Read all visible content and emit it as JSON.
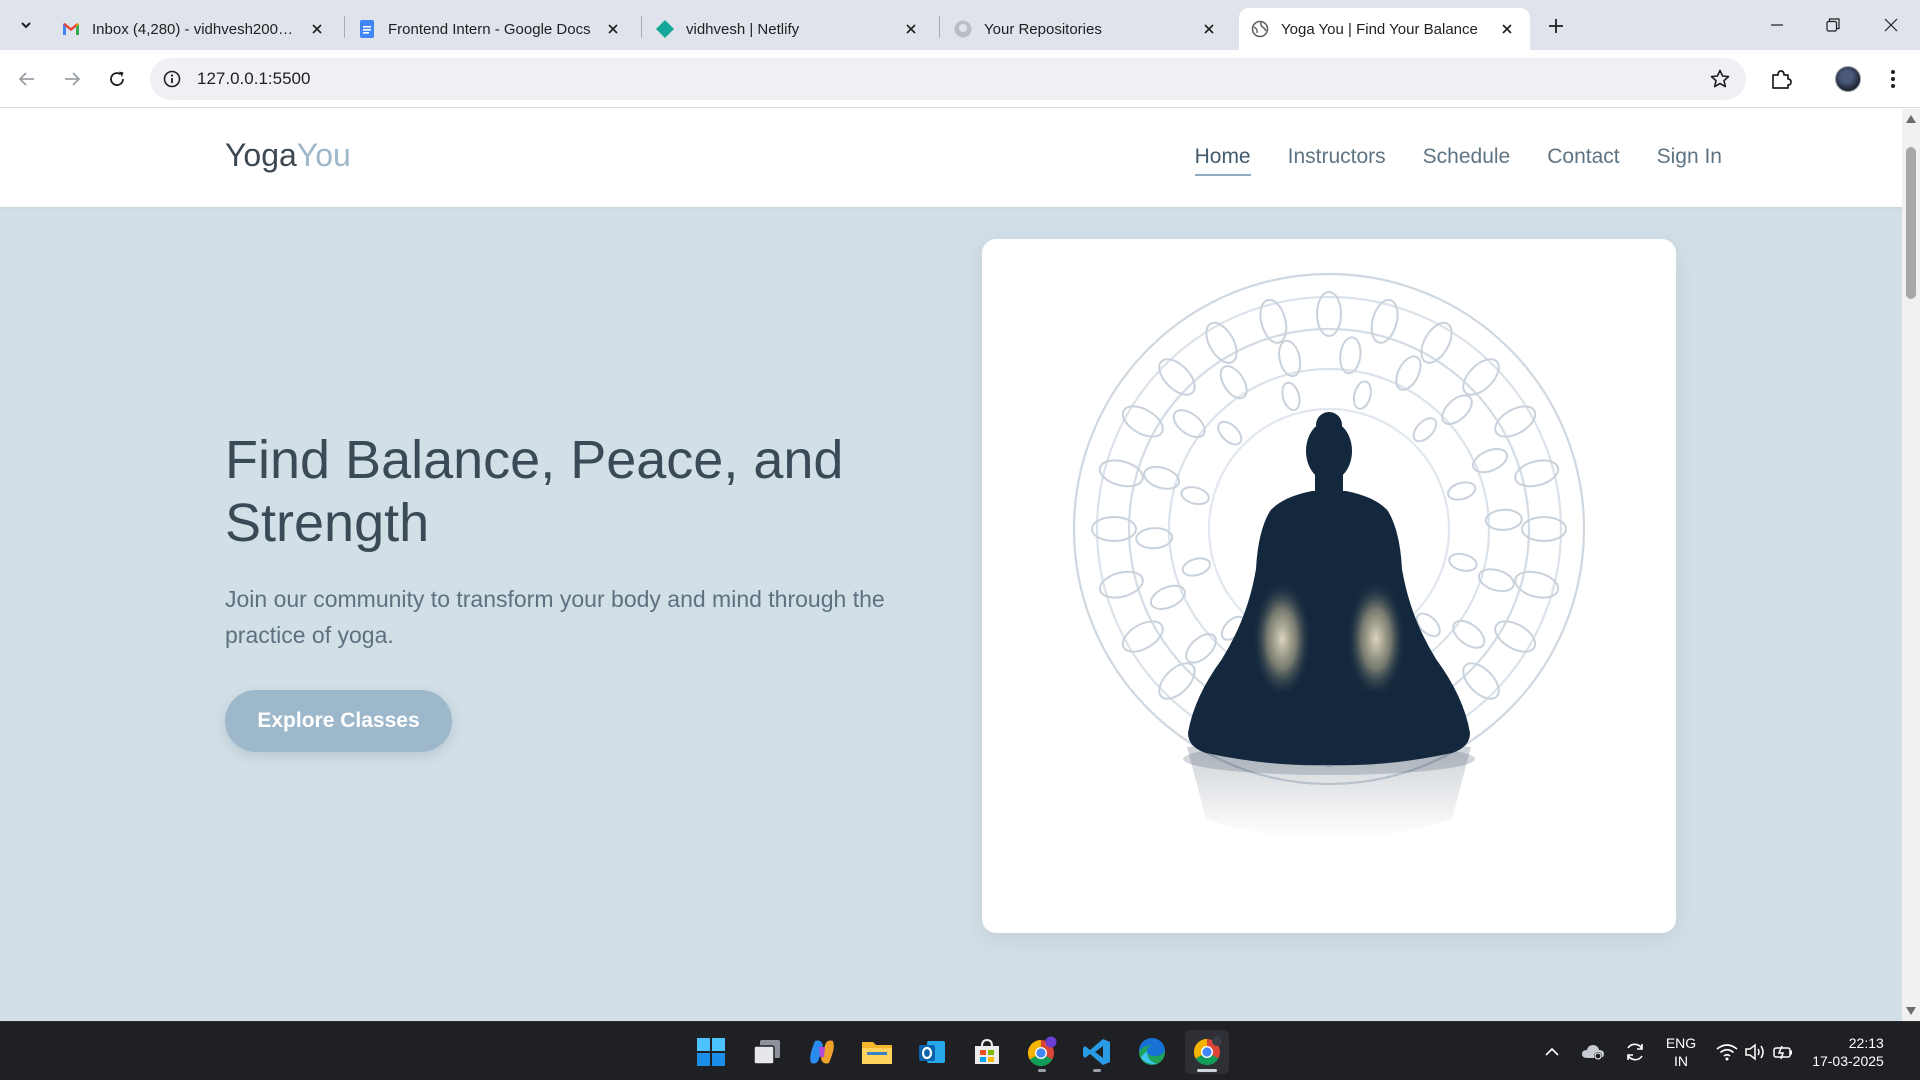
{
  "browser": {
    "tabs": [
      {
        "title": "Inbox (4,280) - vidhvesh2003@gmail.com",
        "favicon": "gmail-icon",
        "active": false
      },
      {
        "title": "Frontend Intern - Google Docs",
        "favicon": "docs-icon",
        "active": false
      },
      {
        "title": "vidhvesh | Netlify",
        "favicon": "netlify-icon",
        "active": false
      },
      {
        "title": "Your Repositories",
        "favicon": "github-icon",
        "active": false
      },
      {
        "title": "Yoga You | Find Your Balance",
        "favicon": "globe-icon",
        "active": true
      }
    ],
    "url": "127.0.0.1:5500"
  },
  "site": {
    "logo_main": "Yoga",
    "logo_accent": "You",
    "nav": [
      "Home",
      "Instructors",
      "Schedule",
      "Contact",
      "Sign In"
    ],
    "active_nav": "Home",
    "hero": {
      "title": "Find Balance, Peace, and Strength",
      "subtitle": "Join our community to transform your body and mind through the practice of yoga.",
      "cta": "Explore Classes"
    }
  },
  "taskbar": {
    "apps": [
      "start-icon",
      "task-view-icon",
      "copilot-icon",
      "file-explorer-icon",
      "outlook-icon",
      "store-icon",
      "chrome-profile-icon",
      "vscode-icon",
      "edge-icon",
      "chrome-icon"
    ],
    "tray": {
      "language": "ENG",
      "region": "IN",
      "time": "22:13",
      "date": "17-03-2025"
    }
  },
  "colors": {
    "page_bg": "#d3dfe7",
    "accent": "#9db7cb",
    "heading": "#3a4a57",
    "silhouette": "#13283d"
  }
}
